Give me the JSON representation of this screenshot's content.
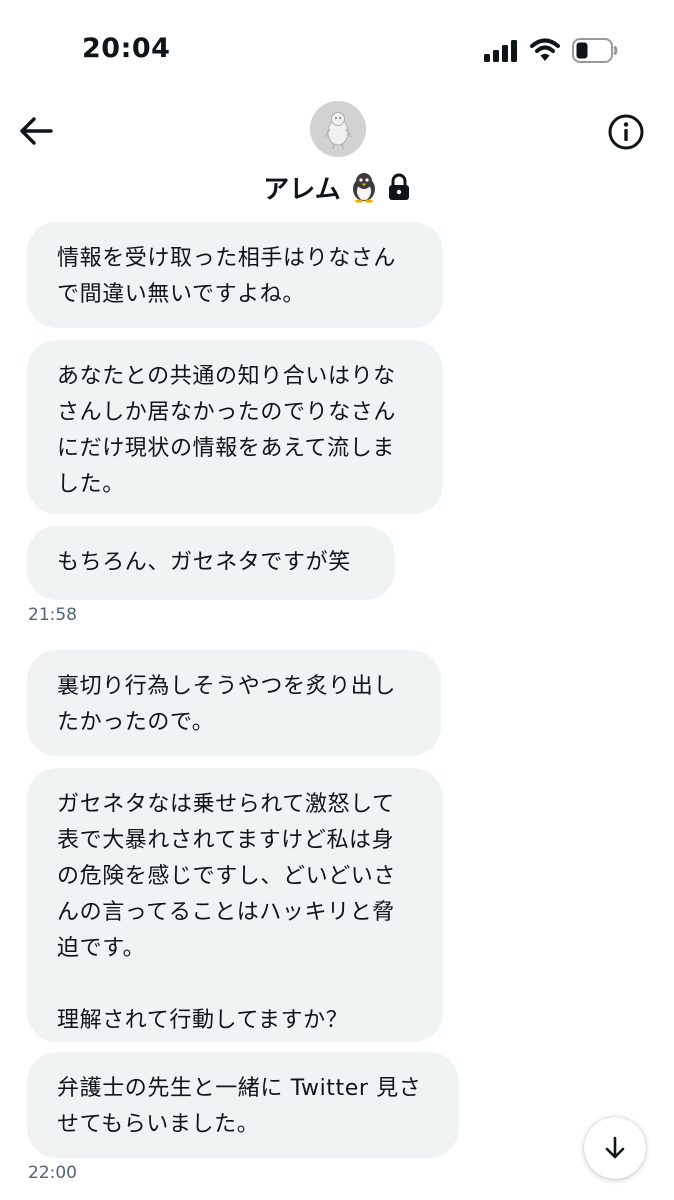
{
  "status_bar": {
    "time": "20:04"
  },
  "header": {
    "name": "アレム",
    "icons": [
      "back-arrow-icon",
      "penguin-icon",
      "lock-icon",
      "info-icon"
    ]
  },
  "colors": {
    "bubble_bg": "#eff3f4",
    "text": "#0f1419",
    "secondary_text": "#536471"
  },
  "messages": [
    {
      "text": "情報を受け取った相手はりなさん\nで間違い無いですよね。"
    },
    {
      "text": "あなたとの共通の知り合いはりな\nさんしか居なかったのでりなさん\nにだけ現状の情報をあえて流しま\nした。"
    },
    {
      "text": "もちろん、ガセネタですが笑"
    },
    {
      "timestamp": "21:58"
    },
    {
      "text": "裏切り行為しそうやつを炙り出し\nたかったので。"
    },
    {
      "text": "ガセネタなは乗せられて激怒して\n表で大暴れされてますけど私は身\nの危険を感じですし、どいどいさ\nんの言ってることはハッキリと脅\n迫です。\n\n理解されて行動してますか？"
    },
    {
      "text": "弁護士の先生と一緒に Twitter 見さ\nせてもらいました。"
    },
    {
      "timestamp": "22:00"
    }
  ]
}
